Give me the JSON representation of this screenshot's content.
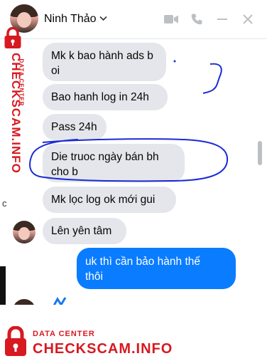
{
  "header": {
    "contact_name": "Ninh Thảo",
    "icons": [
      "video-call-icon",
      "phone-icon",
      "minimize-icon",
      "close-icon"
    ]
  },
  "messages": [
    {
      "sender": "Ninh Thảo",
      "text_line1": "Mk k bao hành ads b",
      "text_line2": "oi"
    },
    {
      "sender": "Ninh Thảo",
      "text": "Bao hanh log in 24h"
    },
    {
      "sender": "Ninh Thảo",
      "text": "Pass 24h"
    },
    {
      "sender": "Ninh Thảo",
      "text_line1": "Die truoc ngày bán bh",
      "text_line2": "cho b"
    },
    {
      "sender": "Ninh Thảo",
      "text": "Mk lọc log ok mới gui"
    },
    {
      "sender": "Ninh Thảo",
      "text": "Lên yên tâm"
    },
    {
      "sender": "me",
      "text_line1": "uk thì cần bảo hành thế",
      "text_line2": "thôi"
    }
  ],
  "watermark": {
    "small": "DATA CENTER",
    "big": "CHECKSCAM.INFO",
    "color": "#d71920"
  },
  "colors": {
    "incoming_bubble": "#e4e6eb",
    "outgoing_bubble": "#0a7cff",
    "annotation": "#1a2bd6"
  },
  "left_edge_glyph": "c"
}
